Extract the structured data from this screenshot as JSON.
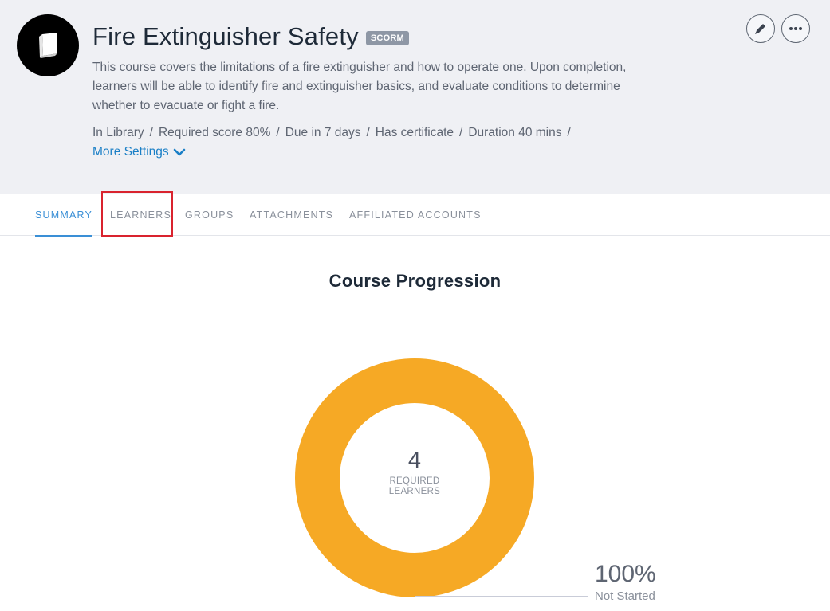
{
  "course": {
    "icon": "book-icon",
    "title": "Fire Extinguisher Safety",
    "badge": "SCORM",
    "description": "This course covers the limitations of a fire extinguisher and how to operate one. Upon completion, learners will be able to identify fire and extinguisher basics, and evaluate conditions to determine whether to evacuate or fight a fire.",
    "meta": [
      "In Library",
      "Required score 80%",
      "Due in 7 days",
      "Has certificate",
      "Duration 40 mins"
    ],
    "meta_separator": "/",
    "more_settings_label": "More Settings"
  },
  "actions": {
    "edit_icon": "pencil-icon",
    "more_icon": "ellipsis-icon"
  },
  "tabs": [
    {
      "label": "SUMMARY",
      "active": true
    },
    {
      "label": "LEARNERS",
      "active": false,
      "highlighted": true
    },
    {
      "label": "GROUPS",
      "active": false
    },
    {
      "label": "ATTACHMENTS",
      "active": false
    },
    {
      "label": "AFFILIATED ACCOUNTS",
      "active": false
    }
  ],
  "progression": {
    "title": "Course Progression",
    "center_count": "4",
    "center_label": "REQUIRED LEARNERS",
    "segment_value": "100%",
    "segment_label": "Not Started"
  },
  "chart_data": {
    "type": "pie",
    "title": "Course Progression",
    "categories": [
      "Not Started"
    ],
    "values": [
      100
    ],
    "unit": "%",
    "colors": [
      "#f6a925"
    ]
  },
  "colors": {
    "accent": "#3a8fd6",
    "link": "#1a7fc6",
    "donut": "#f6a925",
    "highlight_box": "#d9232e",
    "header_bg": "#eff0f4"
  }
}
